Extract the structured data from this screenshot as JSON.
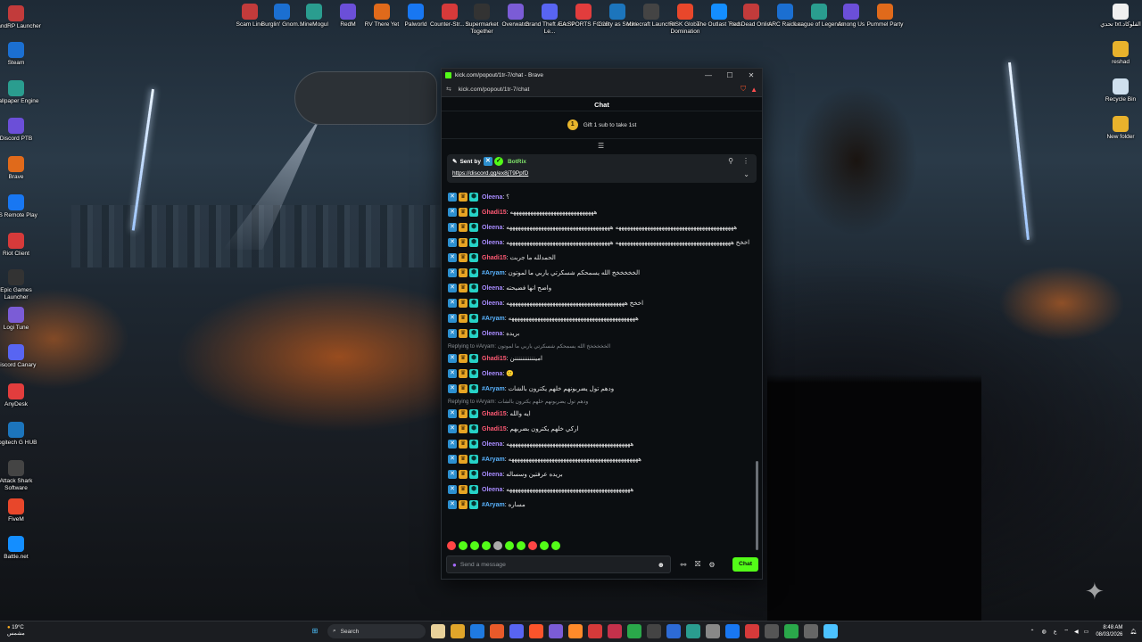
{
  "colors": {
    "kick_green": "#53fc18",
    "oleena": "#a88bff",
    "ghadi": "#ff5a74",
    "aryam": "#5ab4ff"
  },
  "desktop_left": [
    "GrandRP Launcher",
    "Steam",
    "Wallpaper Engine",
    "Discord PTB",
    "Brave",
    "PS Remote Play",
    "Riot Client",
    "Epic Games Launcher",
    "Logi Tune",
    "Discord Canary",
    "AnyDesk",
    "Logitech G HUB",
    "Attack Shark Software",
    "FiveM",
    "Battle.net"
  ],
  "desktop_top": [
    "Scam Line",
    "Burglin' Gnom...",
    "MineMogul",
    "RedM",
    "RV There Yet",
    "Palworld",
    "Counter-Str... 2",
    "Supermarket Together",
    "Overwatch",
    "Grand Theft Auto V Le...",
    "EA SPORTS FC 25",
    "Guilty as Sock!",
    "Minecraft Launcher",
    "RISK Global Domination",
    "The Outlast Trials",
    "Red Dead Online",
    "ARC Raiders",
    "League of Legends",
    "Among Us",
    "Pummel Party"
  ],
  "desktop_right": [
    "تحدي txt.الفلوكاد",
    "reshad",
    "Recycle Bin",
    "New folder"
  ],
  "window": {
    "title": "kick.com/popout/1tr-7/chat - Brave",
    "url": "kick.com/popout/1tr-7/chat",
    "min": "—",
    "max": "☐",
    "close": "✕"
  },
  "chat": {
    "header": "Chat",
    "gift": "Gift 1 sub to take 1st",
    "gift_coin": "1",
    "pinned_by": "Sent by",
    "pinned_user": "BotRix",
    "pinned_link": "https://discord.gg/ex8jT9PpfD",
    "messages": [
      {
        "user": "Oleena",
        "color": "#a88bff",
        "text": "؟"
      },
      {
        "user": "Ghadi15",
        "color": "#ff5a74",
        "text": "هههههههههههههههههههههههههههههه"
      },
      {
        "user": "Oleena",
        "color": "#a88bff",
        "text": "هههههههههههههههههههههههههههههههههههههههههه ههههههههههههههههههههههههههههههههههههه"
      },
      {
        "user": "Oleena",
        "color": "#a88bff",
        "text": "اخخخ ههههههههههههههههههههههههههههههههههههههههه ههههههههههههههههههههههههههههههههههههه"
      },
      {
        "user": "Ghadi15",
        "color": "#ff5a74",
        "text": "الحمدلله ما جربت"
      },
      {
        "user": "#Aryam",
        "color": "#5ab4ff",
        "text": "الخخخخخخ الله يسمحكم شسكرتي ياربي ما لموتون"
      },
      {
        "user": "Oleena",
        "color": "#a88bff",
        "text": "واضح انها فضيحته"
      },
      {
        "user": "Oleena",
        "color": "#a88bff",
        "text": "اخخخ هههههههههههههههههههههههههههههههههههههههههه"
      },
      {
        "user": "#Aryam",
        "color": "#5ab4ff",
        "text": "ههههههههههههههههههههههههههههههههههههههههههههه"
      },
      {
        "user": "Oleena",
        "color": "#a88bff",
        "text": "بريده"
      },
      {
        "reply": "Replying to #Aryam: الخخخخخخ الله يسمحكم شسكرتي ياربي ما لموتون",
        "user": "Ghadi15",
        "color": "#ff5a74",
        "text": "امينننننننننننن"
      },
      {
        "user": "Oleena",
        "color": "#a88bff",
        "text": "🙂"
      },
      {
        "user": "#Aryam",
        "color": "#5ab4ff",
        "text": "ودهم تول يضربونهم خلهم يكترون بالشات"
      },
      {
        "reply": "Replying to #Aryam: ودهم تول يضربونهم خلهم يكترون بالشات",
        "user": "Ghadi15",
        "color": "#ff5a74",
        "text": "ايه والله"
      },
      {
        "user": "Ghadi15",
        "color": "#ff5a74",
        "text": "اركي خلهم يكترون بضربهم"
      },
      {
        "user": "Oleena",
        "color": "#a88bff",
        "text": "هههههههههههههههههههههههههههههههههههههههههههه"
      },
      {
        "user": "#Aryam",
        "color": "#5ab4ff",
        "text": "هههههههههههههههههههههههههههههههههههههههههههههه"
      },
      {
        "user": "Oleena",
        "color": "#a88bff",
        "text": "بريده عرفتين وسساله"
      },
      {
        "user": "Oleena",
        "color": "#a88bff",
        "text": "هههههههههههههههههههههههههههههههههههههههههههه"
      },
      {
        "user": "#Aryam",
        "color": "#5ab4ff",
        "text": "مساره"
      }
    ],
    "input_placeholder": "Send a message",
    "send_label": "Chat"
  },
  "taskbar": {
    "weather_temp": "19°C",
    "weather_desc": "مشمس",
    "search_label": "Search",
    "time": "8:48 AM",
    "date": "08/03/2026",
    "lang": "ع"
  }
}
